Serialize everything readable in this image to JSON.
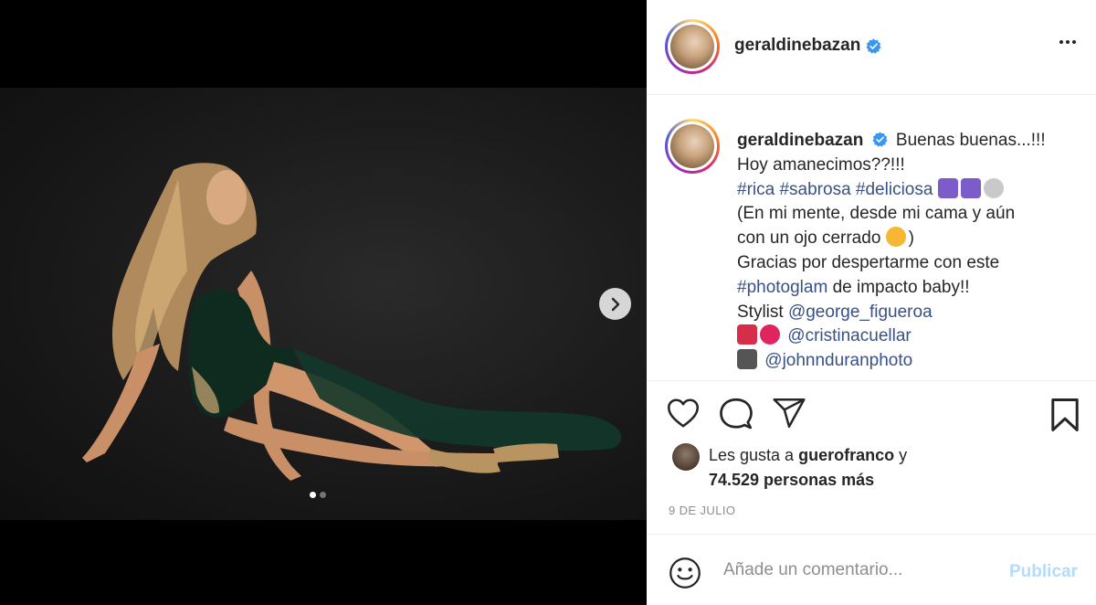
{
  "post": {
    "username": "geraldinebazan",
    "verified": true,
    "more_icon": "more-horizontal-icon"
  },
  "caption": {
    "username": "geraldinebazan",
    "line1": "Buenas buenas...!!!",
    "line2": "Hoy amanecimos??!!!",
    "tags": [
      "#rica",
      "#sabrosa",
      "#deliciosa"
    ],
    "line4": "(En mi mente, desde mi cama y aún",
    "line5": "con un ojo cerrado",
    "line5_end": ")",
    "line6": "Gracias por despertarme con este",
    "tag_photoglam": "#photoglam",
    "line7_rest": " de impacto baby!!",
    "stylist_prefix": "Stylist ",
    "stylist_mention": "@george_figueroa",
    "makeup_mention": "@cristinacuellar",
    "photo_mention": "@johnnduranphoto"
  },
  "likes": {
    "prefix": "Les gusta a ",
    "user": "guerofranco",
    "conj": " y",
    "count": "74.529 personas más"
  },
  "date": "9 DE JULIO",
  "comment": {
    "placeholder": "Añade un comentario...",
    "publish_label": "Publicar"
  },
  "carousel": {
    "current": 1,
    "total": 2
  },
  "colors": {
    "link": "#385185",
    "verified": "#3897f0",
    "publish_disabled": "#b3dbff",
    "muted": "#8e8e8e"
  }
}
